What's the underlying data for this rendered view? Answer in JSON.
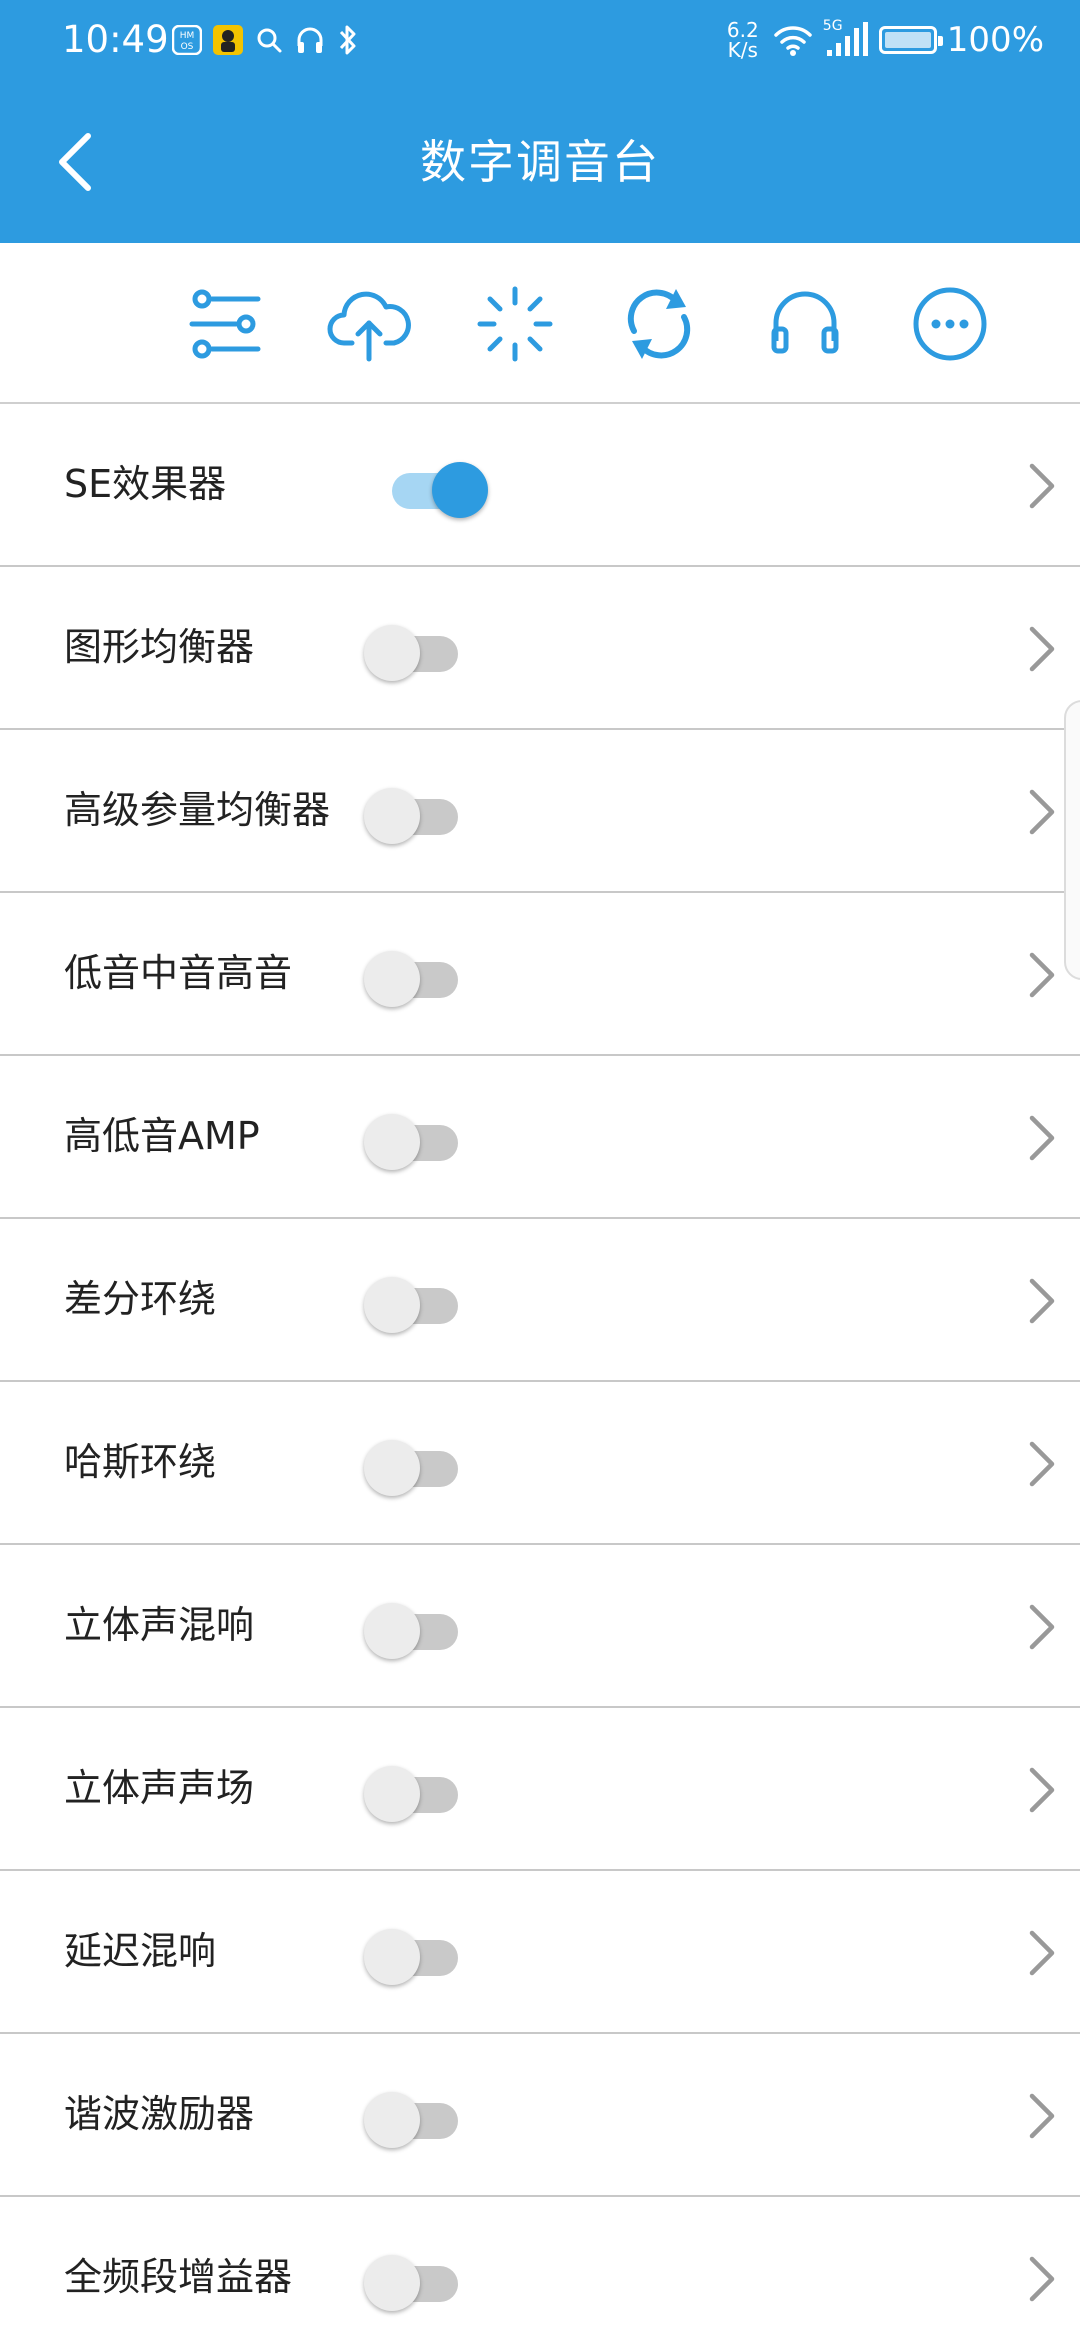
{
  "status_bar": {
    "time": "10:49",
    "net_speed_value": "6.2",
    "net_speed_unit": "K/s",
    "signal_label": "5G",
    "battery": "100%"
  },
  "header": {
    "title": "数字调音台",
    "background_color": "#2d9be0"
  },
  "toolbar": {
    "icons": [
      "sliders-icon",
      "cloud-upload-icon",
      "loading-spinner-icon",
      "refresh-icon",
      "headphones-icon",
      "more-icon"
    ],
    "accent_color": "#2d9be0"
  },
  "effects": [
    {
      "label": "SE效果器",
      "enabled": true
    },
    {
      "label": "图形均衡器",
      "enabled": false
    },
    {
      "label": "高级参量均衡器",
      "enabled": false
    },
    {
      "label": "低音中音高音",
      "enabled": false
    },
    {
      "label": "高低音AMP",
      "enabled": false
    },
    {
      "label": "差分环绕",
      "enabled": false
    },
    {
      "label": "哈斯环绕",
      "enabled": false
    },
    {
      "label": "立体声混响",
      "enabled": false
    },
    {
      "label": "立体声声场",
      "enabled": false
    },
    {
      "label": "延迟混响",
      "enabled": false
    },
    {
      "label": "谐波激励器",
      "enabled": false
    },
    {
      "label": "全频段增益器",
      "enabled": false
    }
  ]
}
